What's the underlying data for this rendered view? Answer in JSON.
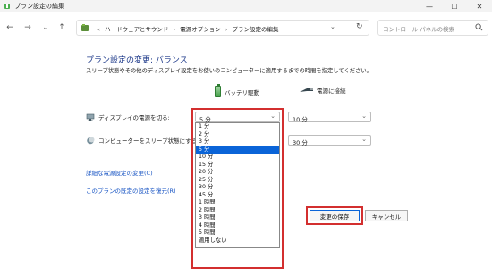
{
  "window": {
    "title": "プラン設定の編集",
    "controls": {
      "minimize": "—",
      "maximize": "☐",
      "close": "✕"
    }
  },
  "nav": {
    "back": "←",
    "forward": "→",
    "recent": "⌄",
    "up": "↑",
    "breadcrumbs": [
      "«",
      "ハードウェアとサウンド",
      "›",
      "電源オプション",
      "›",
      "プラン設定の編集"
    ],
    "refresh": "↻",
    "search_placeholder": "コントロール パネルの検索"
  },
  "main": {
    "heading": "プラン設定の変更: バランス",
    "description": "スリープ状態やその他のディスプレイ設定をお使いのコンピューターに適用するまでの時間を指定してください。",
    "columns": {
      "battery": "バッテリ駆動",
      "plugged": "電源に接続"
    },
    "rows": [
      {
        "label": "ディスプレイの電源を切る:",
        "battery_value": "5 分",
        "plugged_value": "10 分"
      },
      {
        "label": "コンピューターをスリープ状態にする:",
        "battery_value": "",
        "plugged_value": "30 分"
      }
    ],
    "dropdown_options": [
      "1 分",
      "2 分",
      "3 分",
      "5 分",
      "10 分",
      "15 分",
      "20 分",
      "25 分",
      "30 分",
      "45 分",
      "1 時間",
      "2 時間",
      "3 時間",
      "4 時間",
      "5 時間",
      "適用しない"
    ],
    "dropdown_selected_index": 3,
    "links": {
      "advanced": "詳細な電源設定の変更(C)",
      "restore": "このプランの既定の設定を復元(R)"
    },
    "buttons": {
      "save": "変更の保存",
      "cancel": "キャンセル"
    }
  },
  "colors": {
    "highlight": "#d32f2f",
    "selection": "#0a64d8",
    "heading": "#1e3a8a",
    "link": "#1a56c4"
  }
}
